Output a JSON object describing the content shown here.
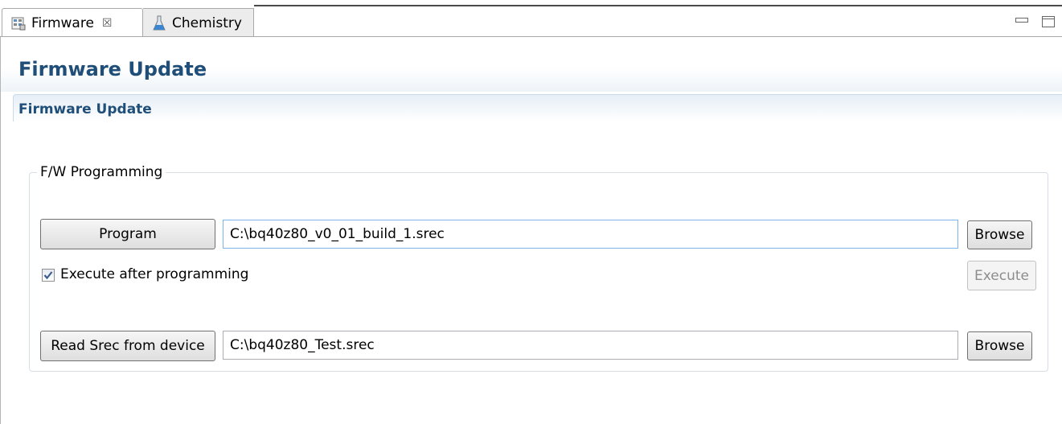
{
  "tabs": [
    {
      "label": "Firmware",
      "close": "☒",
      "icon": "firmware-icon",
      "active": true
    },
    {
      "label": "Chemistry",
      "icon": "flask-icon",
      "active": false
    }
  ],
  "form": {
    "title": "Firmware Update",
    "section_title": "Firmware Update"
  },
  "group": {
    "legend": "F/W Programming",
    "program_button": "Program",
    "program_path": "C:\\bq40z80_v0_01_build_1.srec",
    "browse_button_1": "Browse",
    "execute_checkbox_label": "Execute after programming",
    "execute_checked": true,
    "execute_button": "Execute",
    "read_button": "Read Srec from device",
    "read_path": "C:\\bq40z80_Test.srec",
    "browse_button_2": "Browse"
  },
  "colors": {
    "title_text": "#1f4e79",
    "chemistry_icon": "#3a86d0"
  }
}
